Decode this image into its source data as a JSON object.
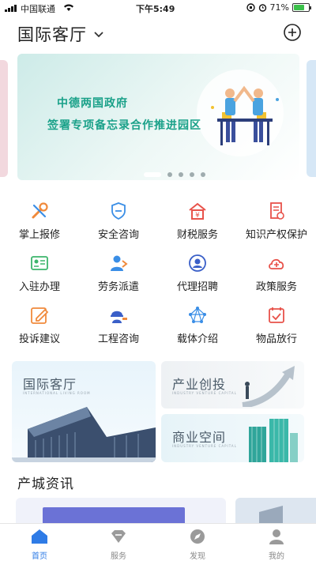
{
  "status_bar": {
    "carrier": "中国联通",
    "time": "下午5:49",
    "battery": "71%",
    "battery_level": 0.71
  },
  "header": {
    "title": "国际客厅",
    "dropdown_icon": "chevron-down-icon",
    "add_icon": "plus-circle-icon"
  },
  "banner": {
    "line1": "中德两国政府",
    "line2": "签署专项备忘录合作推进园区",
    "page_count": 5,
    "active_page": 1
  },
  "services": [
    {
      "label": "掌上报修",
      "icon": "wrench-icon",
      "color": "#f08a3c"
    },
    {
      "label": "安全咨询",
      "icon": "shield-icon",
      "color": "#3a8ee6"
    },
    {
      "label": "财税服务",
      "icon": "finance-icon",
      "color": "#e8524a"
    },
    {
      "label": "知识产权保护",
      "icon": "document-icon",
      "color": "#e8524a"
    },
    {
      "label": "入驻办理",
      "icon": "id-card-icon",
      "color": "#3cb56b"
    },
    {
      "label": "劳务派遣",
      "icon": "worker-icon",
      "color": "#3a8ee6"
    },
    {
      "label": "代理招聘",
      "icon": "recruit-icon",
      "color": "#3a5fc8"
    },
    {
      "label": "政策服务",
      "icon": "cloud-icon",
      "color": "#e8524a"
    },
    {
      "label": "投诉建议",
      "icon": "edit-icon",
      "color": "#f08a3c"
    },
    {
      "label": "工程咨询",
      "icon": "helmet-icon",
      "color": "#3a5fc8"
    },
    {
      "label": "载体介绍",
      "icon": "network-icon",
      "color": "#3a8ee6"
    },
    {
      "label": "物品放行",
      "icon": "checklist-icon",
      "color": "#e8524a"
    }
  ],
  "cards": {
    "big": {
      "title": "国际客厅",
      "subtitle": "INTERNATIONAL LIVING ROOM"
    },
    "sm1": {
      "title": "产业创投",
      "subtitle": "INDUSTRY VENTURE CAPITAL"
    },
    "sm2": {
      "title": "商业空间",
      "subtitle": "INDUSTRY VENTURE CAPITAL"
    }
  },
  "news": {
    "title": "产城资讯"
  },
  "tabs": [
    {
      "label": "首页",
      "icon": "home-icon",
      "active": true
    },
    {
      "label": "服务",
      "icon": "service-icon",
      "active": false
    },
    {
      "label": "发现",
      "icon": "compass-icon",
      "active": false
    },
    {
      "label": "我的",
      "icon": "user-icon",
      "active": false
    }
  ]
}
